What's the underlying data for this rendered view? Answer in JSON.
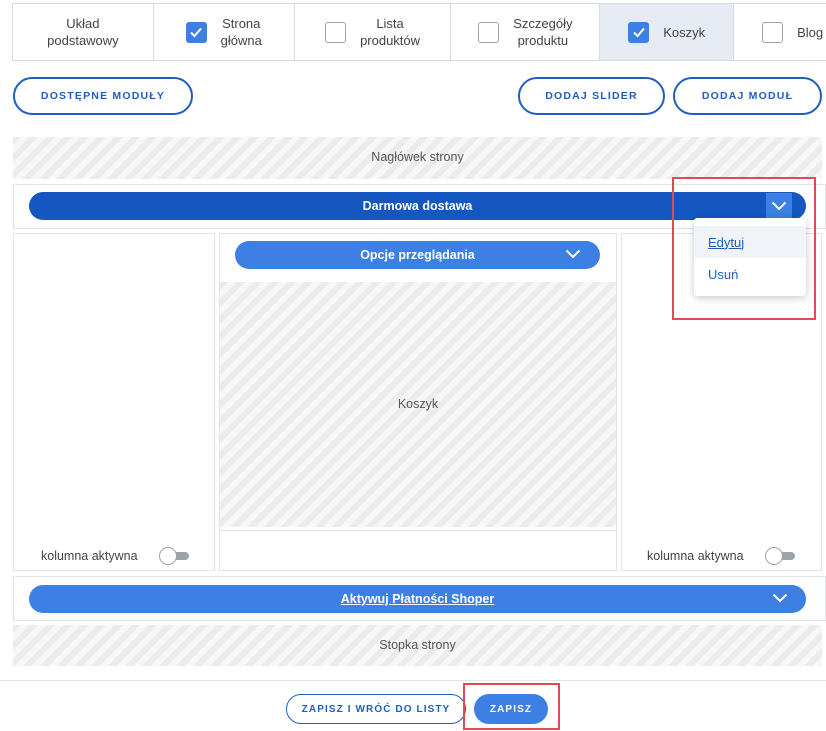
{
  "tabs": [
    {
      "label": "Układ\npodstawowy",
      "checkbox": false
    },
    {
      "label": "Strona\ngłówna",
      "checkbox": true,
      "checked": true
    },
    {
      "label": "Lista\nproduktów",
      "checkbox": true,
      "checked": false
    },
    {
      "label": "Szczegóły\nproduktu",
      "checkbox": true,
      "checked": false
    },
    {
      "label": "Koszyk",
      "checkbox": true,
      "checked": true,
      "active": true
    },
    {
      "label": "Blog",
      "checkbox": true,
      "checked": false
    }
  ],
  "toolbar": {
    "available_modules": "DOSTĘPNE MODUŁY",
    "add_slider": "DODAJ SLIDER",
    "add_module": "DODAJ MODUŁ"
  },
  "layout": {
    "header_zone": "Nagłówek strony",
    "top_module": "Darmowa dostawa",
    "center_module": "Opcje przeglądania",
    "center_zone": "Koszyk",
    "column_active_label": "kolumna aktywna",
    "bottom_module": "Aktywuj Płatności Shoper",
    "footer_zone": "Stopka strony"
  },
  "dropdown": {
    "edit": "Edytuj",
    "delete": "Usuń"
  },
  "footer": {
    "save_and_back": "ZAPISZ I WRÓĆ DO LISTY",
    "save": "ZAPISZ"
  },
  "colors": {
    "accent": "#3d7fe2",
    "accent_dark": "#1557c0",
    "highlight": "#e04a55"
  }
}
